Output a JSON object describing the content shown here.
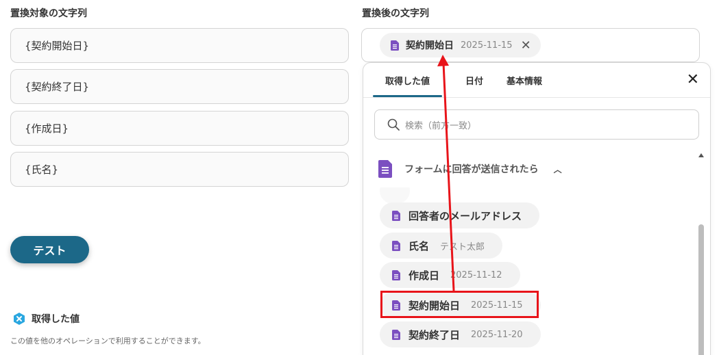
{
  "left": {
    "label": "置換対象の文字列",
    "fields": [
      "{契約開始日}",
      "{契約終了日}",
      "{作成日}",
      "{氏名}"
    ],
    "test_button": "テスト",
    "acquired_title": "取得した値",
    "acquired_desc": "この値を他のオペレーションで利用することができます。"
  },
  "right": {
    "label": "置換後の文字列",
    "chip": {
      "label": "契約開始日",
      "value": "2025-11-15"
    }
  },
  "panel": {
    "tabs": [
      "取得した値",
      "日付",
      "基本情報"
    ],
    "search_placeholder": "検索（前方一致）",
    "group_title": "フォームに回答が送信されたら",
    "items": [
      {
        "label": "回答者のメールアドレス",
        "value": ""
      },
      {
        "label": "氏名",
        "value": "テスト太郎"
      },
      {
        "label": "作成日",
        "value": "2025-11-12"
      },
      {
        "label": "契約開始日",
        "value": "2025-11-15"
      },
      {
        "label": "契約終了日",
        "value": "2025-11-20"
      }
    ]
  },
  "colors": {
    "accent": "#1c6888",
    "form_purple": "#7b4fc0",
    "highlight_red": "#e8141a"
  }
}
